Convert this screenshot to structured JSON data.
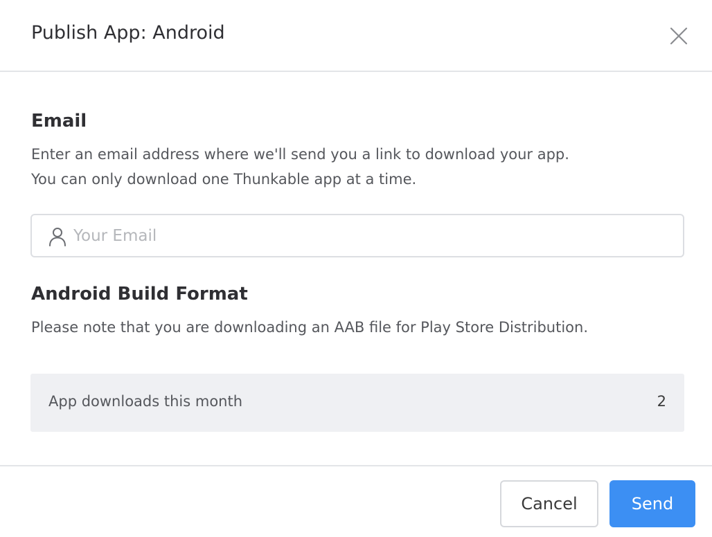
{
  "dialog": {
    "title": "Publish App: Android",
    "close_icon": "close-icon"
  },
  "email_section": {
    "heading": "Email",
    "description_line1": "Enter an email address where we'll send you a link to download your app.",
    "description_line2": "You can only download one Thunkable app at a time.",
    "input": {
      "icon": "user-icon",
      "placeholder": "Your Email",
      "value": ""
    }
  },
  "build_format_section": {
    "heading": "Android Build Format",
    "description": "Please note that you are downloading an AAB file for Play Store Distribution."
  },
  "downloads": {
    "label": "App downloads this month",
    "count": "2"
  },
  "footer": {
    "cancel_label": "Cancel",
    "send_label": "Send"
  },
  "colors": {
    "accent": "#3c8ff3",
    "info_background": "#eff0f3",
    "divider": "#e3e5e8"
  }
}
